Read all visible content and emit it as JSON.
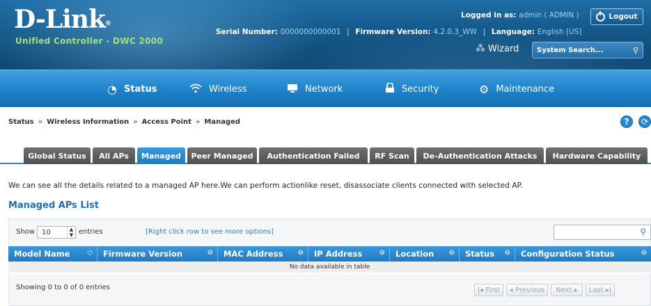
{
  "header": {
    "logo": "D-Link",
    "logo_mark": "®",
    "product": "Unified Controller - DWC 2000",
    "serial_label": "Serial Number:",
    "serial_value": "0000000000001",
    "firmware_label": "Firmware Version:",
    "firmware_value": "4.2.0.3_WW",
    "language_label": "Language:",
    "language_value": "English [US]",
    "logged_label": "Logged in as:",
    "logged_value": "admin ( ADMIN )",
    "logout_label": "Logout",
    "wizard_label": "Wizard",
    "search_placeholder": "System Search..."
  },
  "nav": [
    {
      "label": "Status",
      "icon": "dashboard-icon"
    },
    {
      "label": "Wireless",
      "icon": "wifi-icon"
    },
    {
      "label": "Network",
      "icon": "monitor-icon"
    },
    {
      "label": "Security",
      "icon": "lock-icon"
    },
    {
      "label": "Maintenance",
      "icon": "gears-icon"
    }
  ],
  "breadcrumb": [
    "Status",
    "Wireless Information",
    "Access Point",
    "Managed"
  ],
  "breadcrumb_sep": "»",
  "tabs": [
    "Global Status",
    "All APs",
    "Managed",
    "Peer Managed",
    "Authentication Failed",
    "RF Scan",
    "De-Authentication Attacks",
    "Hardware Capability"
  ],
  "active_tab": "Managed",
  "description": "We can see all the details related to a managed AP here.We can perform actionlike reset, disassociate clients connected with selected AP.",
  "list_title": "Managed APs List",
  "table": {
    "show_label": "Show",
    "show_value": "10",
    "entries_label": "entries",
    "hint": "[Right click row to see more options]",
    "columns": [
      "Model Name",
      "Firmware Version",
      "MAC Address",
      "IP Address",
      "Location",
      "Status",
      "Configuration Status"
    ],
    "empty_message": "No data available in table",
    "showing": "Showing 0 to 0 of 0 entries",
    "pager": {
      "first": "First",
      "previous": "Previous",
      "next": "Next",
      "last": "Last"
    }
  },
  "colors": {
    "accent": "#1f7cc2",
    "header": "#145889",
    "tab_inactive": "#5e6060"
  }
}
